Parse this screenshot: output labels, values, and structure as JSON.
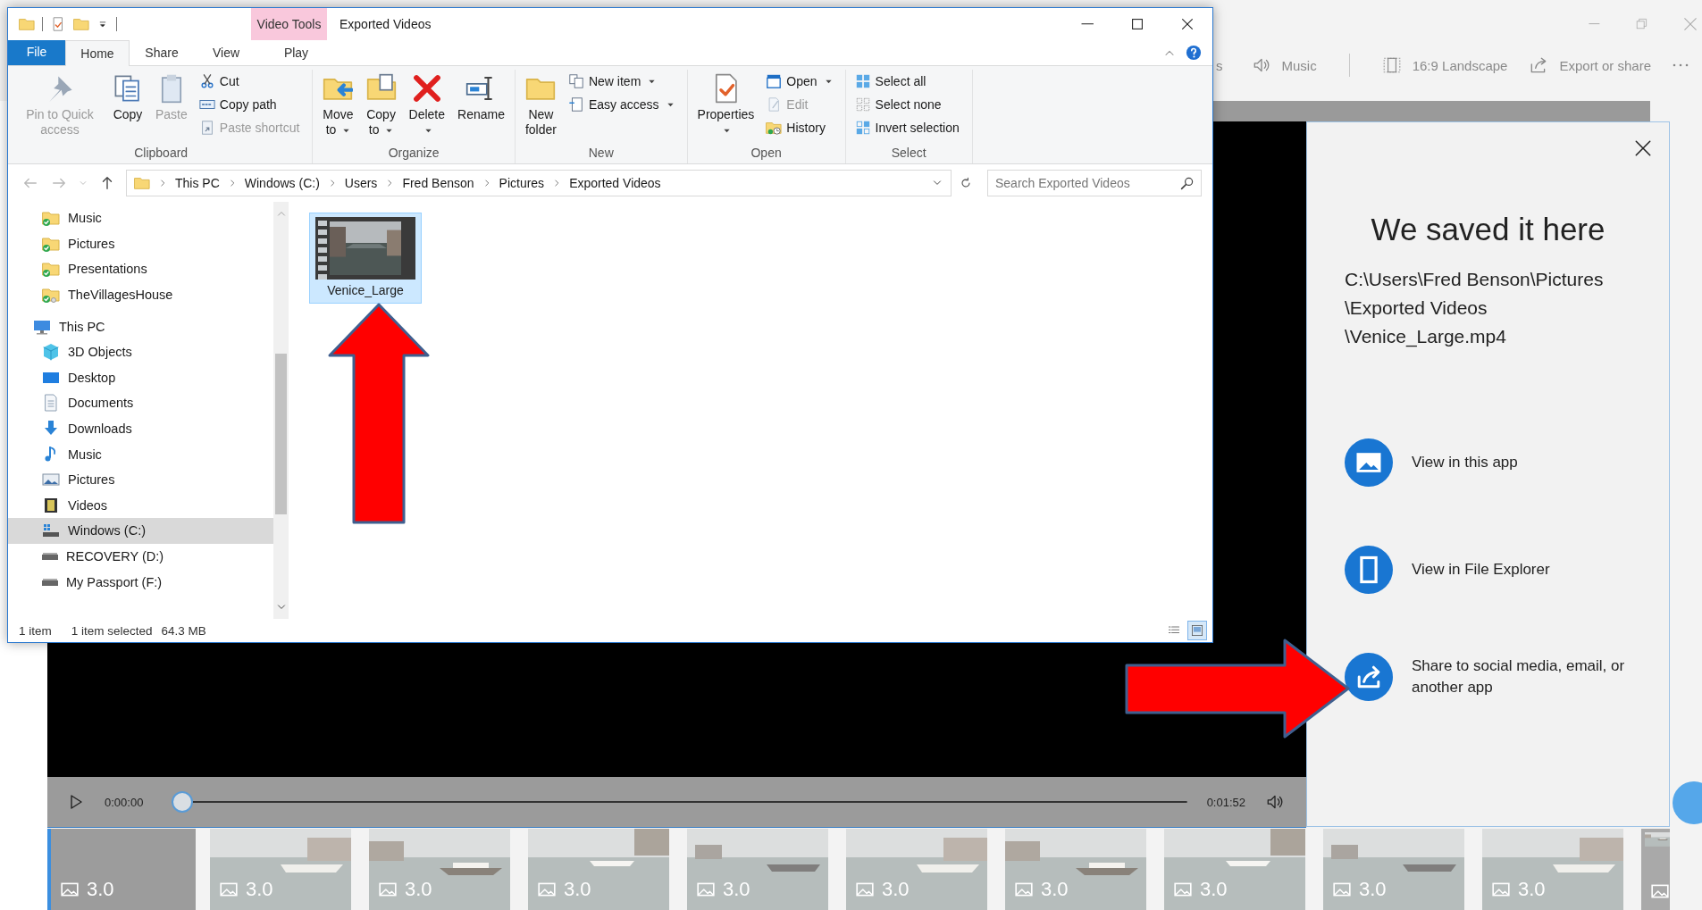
{
  "editor": {
    "toolbar_cut_text": "s",
    "toolbar": [
      {
        "label": "Music",
        "kind": "music"
      },
      {
        "label": "16:9 Landscape",
        "kind": "aspect"
      },
      {
        "label": "Export or share",
        "kind": "export"
      }
    ],
    "player": {
      "elapsed": "0:00:00",
      "duration": "0:01:52",
      "level": 0
    },
    "filmstrip": [
      {
        "duration": "3.0",
        "kind": "blank",
        "selected": true
      },
      {
        "duration": "3.0",
        "kind": "picture",
        "selected": false
      },
      {
        "duration": "3.0",
        "kind": "picture",
        "selected": false
      },
      {
        "duration": "3.0",
        "kind": "picture",
        "selected": false
      },
      {
        "duration": "3.0",
        "kind": "picture",
        "selected": false
      },
      {
        "duration": "3.0",
        "kind": "picture",
        "selected": false
      },
      {
        "duration": "3.0",
        "kind": "picture",
        "selected": false
      },
      {
        "duration": "3.0",
        "kind": "picture",
        "selected": false
      },
      {
        "duration": "3.0",
        "kind": "picture",
        "selected": false
      },
      {
        "duration": "3.0",
        "kind": "picture",
        "selected": false
      },
      {
        "kind": "picture",
        "selected": false
      }
    ]
  },
  "saved_panel": {
    "title": "We saved it here",
    "path": [
      "C:\\Users\\Fred Benson\\Pictures",
      "\\Exported Videos",
      "\\Venice_Large.mp4"
    ],
    "actions": [
      {
        "label": "View in this app"
      },
      {
        "label": "View in File Explorer",
        "kind": "device"
      },
      {
        "label": "Share to social media, email, or another app",
        "kind": "share"
      }
    ]
  },
  "explorer": {
    "title": "Exported Videos",
    "tabs": [
      {
        "label": "File",
        "kind": "file",
        "selected": false
      },
      {
        "label": "Home",
        "kind": "tab",
        "selected": true
      },
      {
        "label": "Share",
        "kind": "tab",
        "selected": false
      },
      {
        "label": "View",
        "kind": "tab",
        "selected": false
      }
    ],
    "contextual": {
      "title": "Video Tools",
      "tabs": [
        {
          "label": "Play",
          "selected": false
        }
      ]
    },
    "ribbon": [
      {
        "label": "Clipboard",
        "large": [
          {
            "label": "Pin to Quick access",
            "kind": "pin",
            "disabled": true,
            "dropdown": false
          },
          {
            "label": "Copy",
            "kind": "copy",
            "disabled": false,
            "dropdown": false
          },
          {
            "label": "Paste",
            "kind": "paste",
            "disabled": true,
            "dropdown": false
          }
        ],
        "small": [
          {
            "label": "Cut",
            "kind": "cut",
            "disabled": false,
            "dropdown": false
          },
          {
            "label": "Copy path",
            "kind": "copy-path",
            "disabled": false,
            "dropdown": false
          },
          {
            "label": "Paste shortcut",
            "kind": "paste-shortcut",
            "disabled": true,
            "dropdown": false
          }
        ]
      },
      {
        "label": "Organize",
        "large": [
          {
            "label": "Move to",
            "kind": "move",
            "disabled": false,
            "dropdown": true
          },
          {
            "label": "Copy to",
            "kind": "copy-to",
            "disabled": false,
            "dropdown": true
          },
          {
            "label": "Delete",
            "kind": "delete",
            "disabled": false,
            "dropdown": true
          },
          {
            "label": "Rename",
            "kind": "rename",
            "disabled": false,
            "dropdown": false
          }
        ]
      },
      {
        "label": "New",
        "large": [
          {
            "label": "New folder",
            "kind": "new-folder",
            "disabled": false,
            "dropdown": false
          }
        ],
        "small": [
          {
            "label": "New item",
            "kind": "new-item",
            "disabled": false,
            "dropdown": true
          },
          {
            "label": "Easy access",
            "kind": "easy-access",
            "disabled": false,
            "dropdown": true
          }
        ]
      },
      {
        "label": "Open",
        "large": [
          {
            "label": "Properties",
            "kind": "properties",
            "disabled": false,
            "dropdown": true
          }
        ],
        "small": [
          {
            "label": "Open",
            "kind": "open",
            "disabled": false,
            "dropdown": true
          },
          {
            "label": "Edit",
            "kind": "edit",
            "disabled": true,
            "dropdown": false
          },
          {
            "label": "History",
            "kind": "history",
            "disabled": false,
            "dropdown": false
          }
        ]
      },
      {
        "label": "Select",
        "small": [
          {
            "label": "Select all",
            "kind": "select-all",
            "disabled": false,
            "dropdown": false
          },
          {
            "label": "Select none",
            "kind": "select-none",
            "disabled": false,
            "dropdown": false
          },
          {
            "label": "Invert selection",
            "kind": "invert",
            "disabled": false,
            "dropdown": false
          }
        ]
      }
    ],
    "address": {
      "crumbs": [
        "This PC",
        "Windows (C:)",
        "Users",
        "Fred Benson",
        "Pictures",
        "Exported Videos"
      ]
    },
    "search": {
      "placeholder": "Search Exported Videos"
    },
    "nav": [
      {
        "children": [
          {
            "label": "Music",
            "kind": "synced-folder",
            "selected": false
          },
          {
            "label": "Pictures",
            "kind": "synced-folder",
            "selected": false
          },
          {
            "label": "Presentations",
            "kind": "synced-folder",
            "selected": false
          },
          {
            "label": "TheVillagesHouse",
            "kind": "shared-folder",
            "selected": false
          }
        ]
      },
      {
        "label": "This PC",
        "kind": "pc",
        "selected": false,
        "children": [
          {
            "label": "3D Objects",
            "kind": "cube",
            "selected": false
          },
          {
            "label": "Desktop",
            "kind": "desktop",
            "selected": false
          },
          {
            "label": "Documents",
            "kind": "documents",
            "selected": false
          },
          {
            "label": "Downloads",
            "kind": "downloads",
            "selected": false
          },
          {
            "label": "Music",
            "kind": "music",
            "selected": false
          },
          {
            "label": "Pictures",
            "kind": "pictures",
            "selected": false
          },
          {
            "label": "Videos",
            "kind": "videos",
            "selected": false
          },
          {
            "label": "Windows (C:)",
            "kind": "drive-windows",
            "selected": true
          },
          {
            "label": "RECOVERY (D:)",
            "kind": "drive",
            "selected": false
          },
          {
            "label": "My Passport (F:)",
            "kind": "drive",
            "selected": false
          }
        ]
      }
    ],
    "files": [
      {
        "name": "Venice_Large",
        "selected": true
      }
    ],
    "status": {
      "count": "1 item",
      "selection": "1 item selected",
      "size": "64.3 MB"
    },
    "views": [
      {
        "kind": "details",
        "selected": false
      },
      {
        "kind": "large-icons",
        "selected": true
      }
    ]
  },
  "annotations": [
    {
      "kind": "arrow-up"
    },
    {
      "kind": "arrow-right"
    }
  ]
}
